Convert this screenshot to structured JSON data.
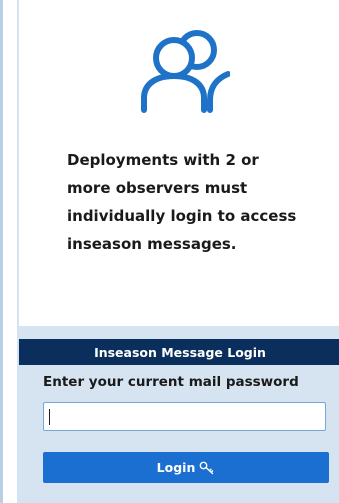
{
  "message": {
    "line1": "Deployments with 2 or",
    "line2": "more observers must",
    "line3": "individually login to access",
    "line4": "inseason messages."
  },
  "login": {
    "header": "Inseason Message Login",
    "field_label": "Enter your current mail password",
    "password_value": "",
    "button_label": "Login"
  },
  "icons": {
    "users": "users-icon",
    "key": "key-icon"
  },
  "colors": {
    "header_bg": "#0b2f5c",
    "panel_bg": "#d6e4f2",
    "button_bg": "#1a6fd1",
    "icon_blue": "#1e73c8",
    "input_border": "#7aa6d6"
  }
}
